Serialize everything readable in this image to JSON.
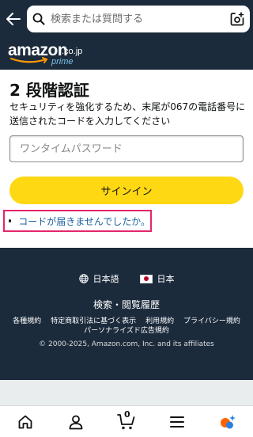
{
  "header": {
    "search_placeholder": "検索または質問する"
  },
  "logo": {
    "word": "amazon",
    "suffix": ".co.jp",
    "prime": "prime"
  },
  "main": {
    "title": "2 段階認証",
    "description": "セキュリティを強化するため、末尾が067の電話番号に送信されたコードを入力してください",
    "otp_placeholder": "ワンタイムパスワード",
    "signin_label": "サインイン",
    "help_link": "コードが届きませんでしたか。",
    "highlight_color": "#e3266b",
    "button_color": "#ffd814"
  },
  "footer": {
    "language": "日本語",
    "region": "日本",
    "history": "検索・閲覧履歴",
    "links": [
      "各種規約",
      "特定商取引法に基づく表示",
      "利用規約",
      "プライバシー規約"
    ],
    "ads_link": "パーソナライズド広告規約",
    "copyright": "© 2000-2025, Amazon.com, Inc. and its affiliates",
    "bg_color": "#1c2b3c"
  },
  "bottom_nav": {
    "cart_count": "0",
    "items": [
      "home-icon",
      "account-icon",
      "cart-icon",
      "menu-icon",
      "rufus-icon"
    ]
  }
}
